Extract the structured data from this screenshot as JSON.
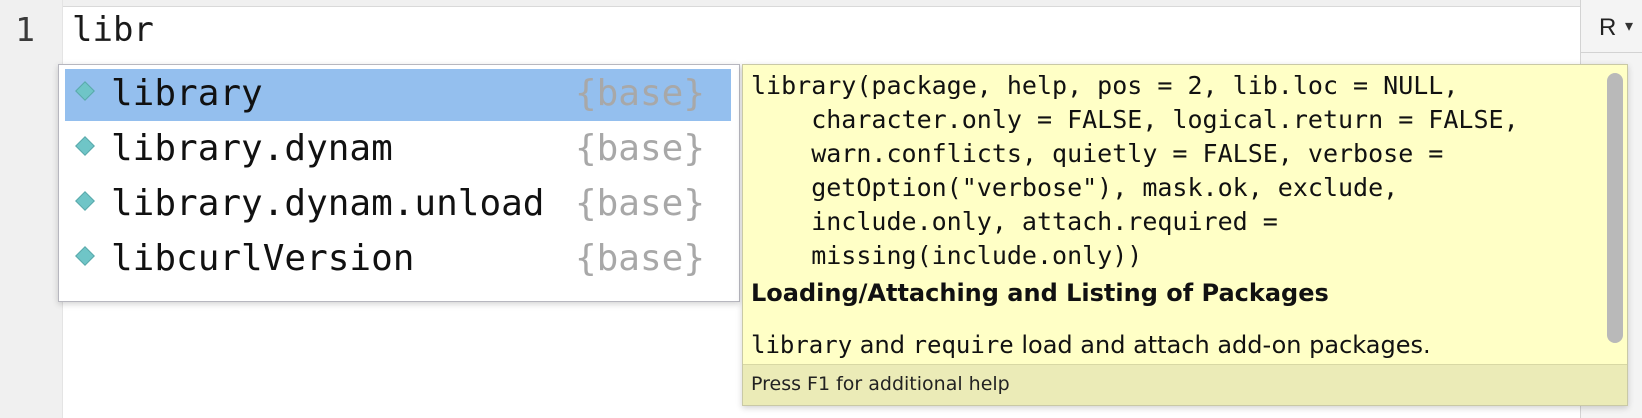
{
  "editor": {
    "line_number": "1",
    "text": "libr"
  },
  "right_panel": {
    "language": "R",
    "language_caret": "▾"
  },
  "completion": {
    "items": [
      {
        "label": "library",
        "package": "{base}",
        "selected": true
      },
      {
        "label": "library.dynam",
        "package": "{base}",
        "selected": false
      },
      {
        "label": "library.dynam.unload",
        "package": "{base}",
        "selected": false
      },
      {
        "label": "libcurlVersion",
        "package": "{base}",
        "selected": false
      }
    ]
  },
  "help": {
    "signature_lines": [
      "library(package, help, pos = 2, lib.loc = NULL,",
      "    character.only = FALSE, logical.return = FALSE,",
      "    warn.conflicts, quietly = FALSE, verbose =",
      "    getOption(\"verbose\"), mask.ok, exclude,",
      "    include.only, attach.required =",
      "    missing(include.only))"
    ],
    "title": "Loading/Attaching and Listing of Packages",
    "description": {
      "code1": "library",
      "text1": " and ",
      "code2": "require",
      "text2": " load and attach add-on packages."
    },
    "footer": "Press F1 for additional help"
  },
  "colors": {
    "selection": "#94bfee",
    "tooltip_bg": "#ffffc6",
    "function_icon": "#6fc5c7"
  }
}
